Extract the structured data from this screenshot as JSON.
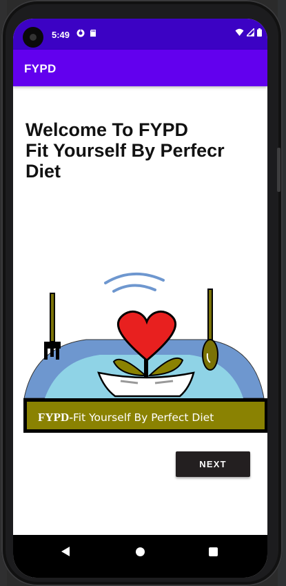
{
  "status_bar": {
    "time": "5:49",
    "icons": [
      "screen-record-icon",
      "sd-card-icon",
      "wifi-icon",
      "signal-icon",
      "battery-icon"
    ]
  },
  "app_bar": {
    "title": "FYPD",
    "color": "#6200ee"
  },
  "welcome": {
    "line1": "Welcome To FYPD",
    "line2": "Fit Yourself By Perfecr",
    "line3": "Diet"
  },
  "banner": {
    "bold": "FYPD-",
    "text": "Fit Yourself By Perfect Diet",
    "color": "#8a8202"
  },
  "next_button": {
    "label": "NEXT"
  },
  "nav_bar": {
    "icons": [
      "back-icon",
      "home-icon",
      "recents-icon"
    ]
  }
}
